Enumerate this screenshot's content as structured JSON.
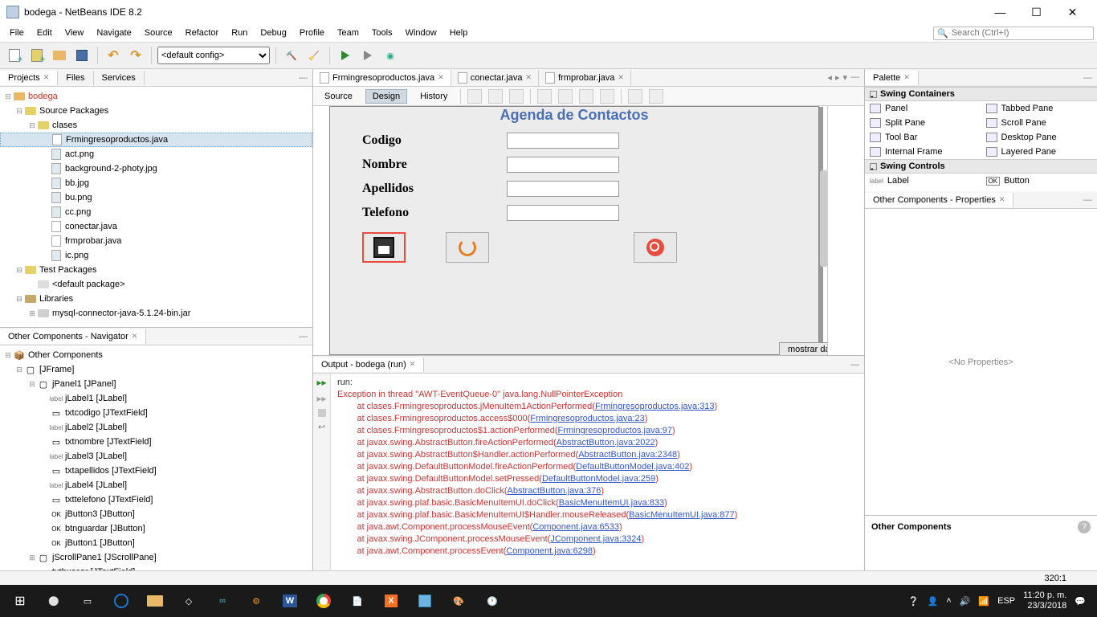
{
  "window": {
    "title": "bodega - NetBeans IDE 8.2"
  },
  "menubar": [
    "File",
    "Edit",
    "View",
    "Navigate",
    "Source",
    "Refactor",
    "Run",
    "Debug",
    "Profile",
    "Team",
    "Tools",
    "Window",
    "Help"
  ],
  "search_placeholder": "Search (Ctrl+I)",
  "config_select": "<default config>",
  "left_tabs": {
    "projects": "Projects",
    "files": "Files",
    "services": "Services"
  },
  "project_tree": {
    "root": "bodega",
    "source_packages": "Source Packages",
    "pkg_clases": "clases",
    "files_clases": [
      "Frmingresoproductos.java",
      "act.png",
      "background-2-photy.jpg",
      "bb.jpg",
      "bu.png",
      "cc.png",
      "conectar.java",
      "frmprobar.java",
      "ic.png"
    ],
    "test_packages": "Test Packages",
    "default_pkg": "<default package>",
    "libraries": "Libraries",
    "lib1": "mysql-connector-java-5.1.24-bin.jar"
  },
  "navigator": {
    "title": "Other Components - Navigator",
    "root": "Other Components",
    "jframe": "[JFrame]",
    "items": [
      "jPanel1 [JPanel]",
      "jLabel1 [JLabel]",
      "txtcodigo [JTextField]",
      "jLabel2 [JLabel]",
      "txtnombre [JTextField]",
      "jLabel3 [JLabel]",
      "txtapellidos [JTextField]",
      "jLabel4 [JLabel]",
      "txttelefono [JTextField]",
      "jButton3 [JButton]",
      "btnguardar [JButton]",
      "jButton1 [JButton]",
      "jScrollPane1 [JScrollPane]",
      "txtbuscar [JTextField]"
    ]
  },
  "editor_tabs": [
    "Frmingresoproductos.java",
    "conectar.java",
    "frmprobar.java"
  ],
  "editor_sub": {
    "source": "Source",
    "design": "Design",
    "history": "History"
  },
  "form": {
    "title": "Agenda de Contactos",
    "labels": {
      "codigo": "Codigo",
      "nombre": "Nombre",
      "apellidos": "Apellidos",
      "telefono": "Telefono"
    },
    "mostrar": "mostrar datos"
  },
  "output": {
    "title": "Output - bodega (run)",
    "run_label": "run:",
    "exception": "Exception in thread \"AWT-EventQueue-0\" java.lang.NullPointerException",
    "lines": [
      {
        "pre": "        at clases.Frmingresoproductos.jMenuItem1ActionPerformed(",
        "link": "Frmingresoproductos.java:313",
        "post": ")"
      },
      {
        "pre": "        at clases.Frmingresoproductos.access$000(",
        "link": "Frmingresoproductos.java:23",
        "post": ")"
      },
      {
        "pre": "        at clases.Frmingresoproductos$1.actionPerformed(",
        "link": "Frmingresoproductos.java:97",
        "post": ")"
      },
      {
        "pre": "        at javax.swing.AbstractButton.fireActionPerformed(",
        "link": "AbstractButton.java:2022",
        "post": ")"
      },
      {
        "pre": "        at javax.swing.AbstractButton$Handler.actionPerformed(",
        "link": "AbstractButton.java:2348",
        "post": ")"
      },
      {
        "pre": "        at javax.swing.DefaultButtonModel.fireActionPerformed(",
        "link": "DefaultButtonModel.java:402",
        "post": ")"
      },
      {
        "pre": "        at javax.swing.DefaultButtonModel.setPressed(",
        "link": "DefaultButtonModel.java:259",
        "post": ")"
      },
      {
        "pre": "        at javax.swing.AbstractButton.doClick(",
        "link": "AbstractButton.java:376",
        "post": ")"
      },
      {
        "pre": "        at javax.swing.plaf.basic.BasicMenuItemUI.doClick(",
        "link": "BasicMenuItemUI.java:833",
        "post": ")"
      },
      {
        "pre": "        at javax.swing.plaf.basic.BasicMenuItemUI$Handler.mouseReleased(",
        "link": "BasicMenuItemUI.java:877",
        "post": ")"
      },
      {
        "pre": "        at java.awt.Component.processMouseEvent(",
        "link": "Component.java:6533",
        "post": ")"
      },
      {
        "pre": "        at javax.swing.JComponent.processMouseEvent(",
        "link": "JComponent.java:3324",
        "post": ")"
      },
      {
        "pre": "        at java.awt.Component.processEvent(",
        "link": "Component.java:6298",
        "post": ")"
      }
    ]
  },
  "palette": {
    "title": "Palette",
    "containers_header": "Swing Containers",
    "containers": [
      "Panel",
      "Tabbed Pane",
      "Split Pane",
      "Scroll Pane",
      "Tool Bar",
      "Desktop Pane",
      "Internal Frame",
      "Layered Pane"
    ],
    "controls_header": "Swing Controls",
    "controls": [
      "Label",
      "Button"
    ]
  },
  "properties": {
    "title": "Other Components - Properties",
    "empty": "<No Properties>"
  },
  "other_components_title": "Other Components",
  "statusbar": {
    "position": "320:1"
  },
  "taskbar": {
    "lang": "ESP",
    "time": "11:20 p. m.",
    "date": "23/3/2018"
  }
}
